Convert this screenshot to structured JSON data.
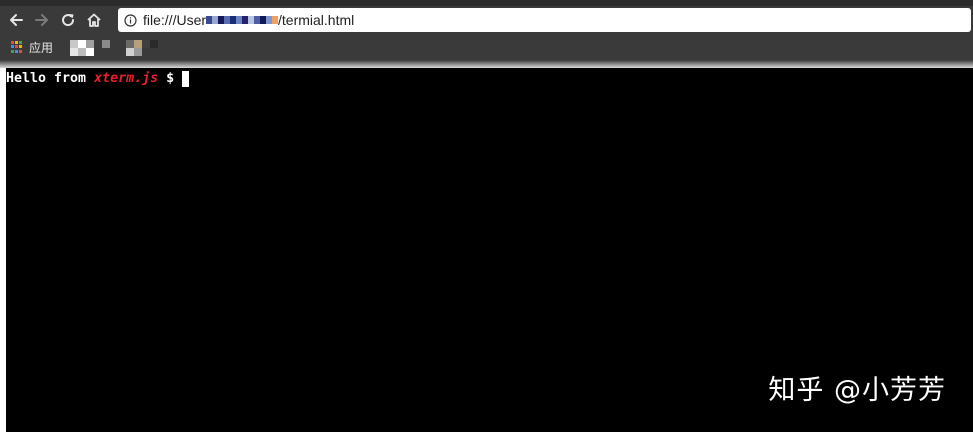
{
  "toolbar": {
    "back_icon": "arrow-left-icon",
    "forward_icon": "arrow-right-icon",
    "reload_icon": "reload-icon",
    "home_icon": "home-icon",
    "info_icon": "info-icon",
    "url_prefix": "file:///User",
    "url_suffix": "/termial.html",
    "url_redaction_colors": [
      "#3a4a8c",
      "#9aa8d0",
      "#15195a",
      "#5b6cb0",
      "#1a2d78",
      "#6f86c4",
      "#25246a",
      "#b8c4e4",
      "#4b5ea6",
      "#0d1a57",
      "#7f95ce",
      "#f0a060"
    ]
  },
  "bookmarks": {
    "apps_label": "应用",
    "apps_icon": "apps-grid-icon",
    "apps_icon_colors": [
      "#e84a3c",
      "#f5b400",
      "#3aa757",
      "#4a8af4",
      "#e84a3c",
      "#f5b400",
      "#3aa757",
      "#4a8af4",
      "#e84a3c"
    ]
  },
  "terminal": {
    "prefix": "Hello from ",
    "highlight": "xterm.js",
    "prompt": " $ ",
    "highlight_color": "#e8202a",
    "background": "#000000",
    "foreground": "#ffffff"
  },
  "watermark": {
    "text": "知乎 @小芳芳"
  }
}
